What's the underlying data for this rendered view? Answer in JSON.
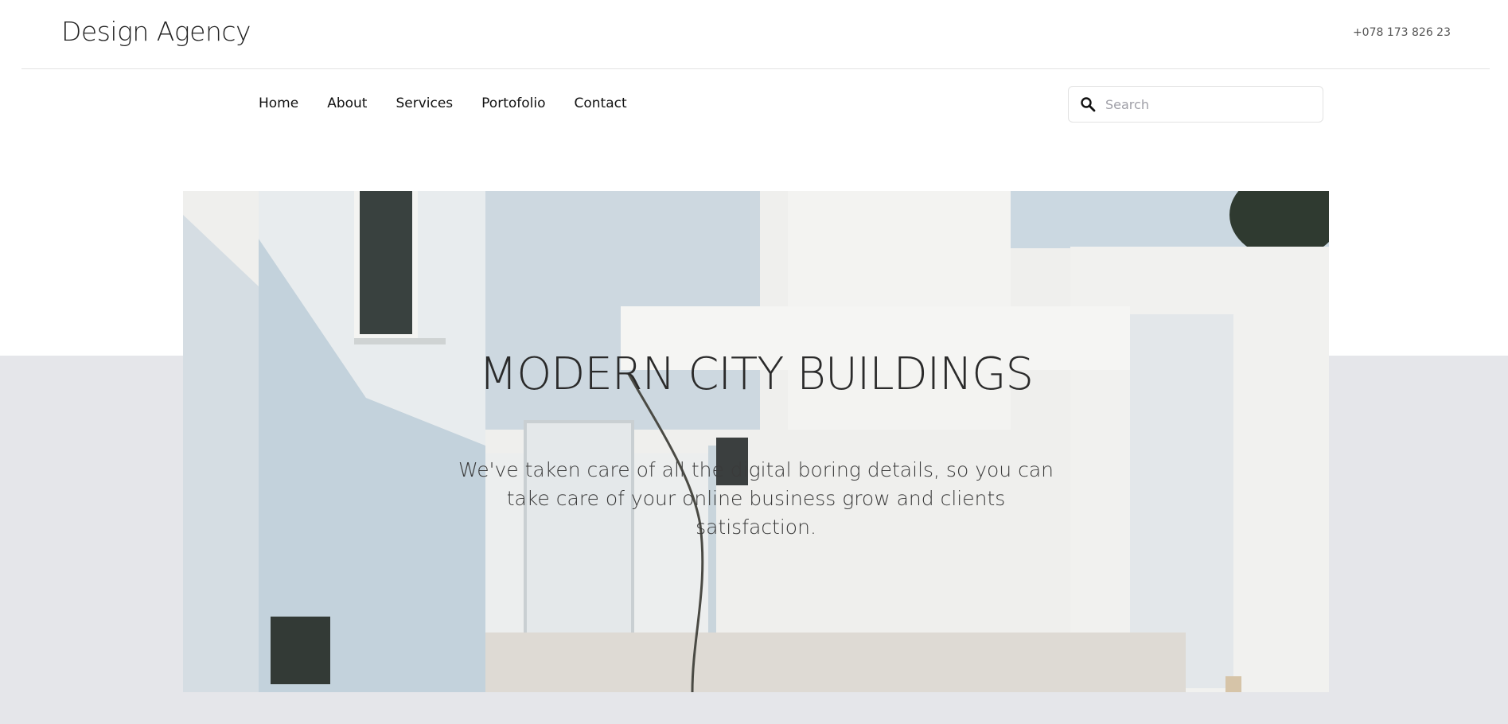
{
  "header": {
    "brand": "Design Agency",
    "phone": "+078 173 826 23"
  },
  "nav": {
    "items": [
      {
        "label": "Home"
      },
      {
        "label": "About"
      },
      {
        "label": "Services"
      },
      {
        "label": "Portofolio"
      },
      {
        "label": "Contact"
      }
    ]
  },
  "search": {
    "placeholder": "Search",
    "value": "",
    "icon": "search-icon"
  },
  "hero": {
    "title": "MODERN CITY BUILDINGS",
    "text": "We've taken care of all the digital boring details, so you can take care of your online business grow and clients satisfaction."
  },
  "colors": {
    "band": "#e5e6ea",
    "text": "#222222"
  }
}
